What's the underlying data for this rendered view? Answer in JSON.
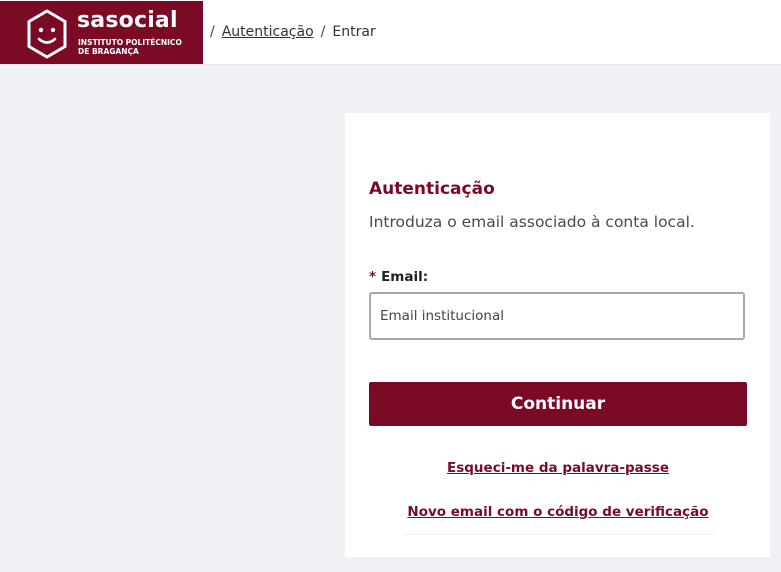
{
  "brand": {
    "name": "sasocial",
    "subtitle": "INSTITUTO POLITÉCNICO\nDE BRAGANÇA",
    "color": "#7a0a26"
  },
  "breadcrumb": {
    "separator": "/",
    "items": [
      {
        "label": "Autenticação",
        "link": true
      },
      {
        "label": "Entrar",
        "link": false
      }
    ]
  },
  "login": {
    "title": "Autenticação",
    "description": "Introduza o email associado à conta local.",
    "email_required_marker": "*",
    "email_label": "Email:",
    "email_placeholder": "Email institucional",
    "email_value": "",
    "submit_label": "Continuar",
    "forgot_password_link": "Esqueci-me da palavra-passe",
    "new_email_code_link": "Novo email com o código de verificação"
  },
  "icons": {
    "logo": "smiley-hexagon-icon"
  }
}
